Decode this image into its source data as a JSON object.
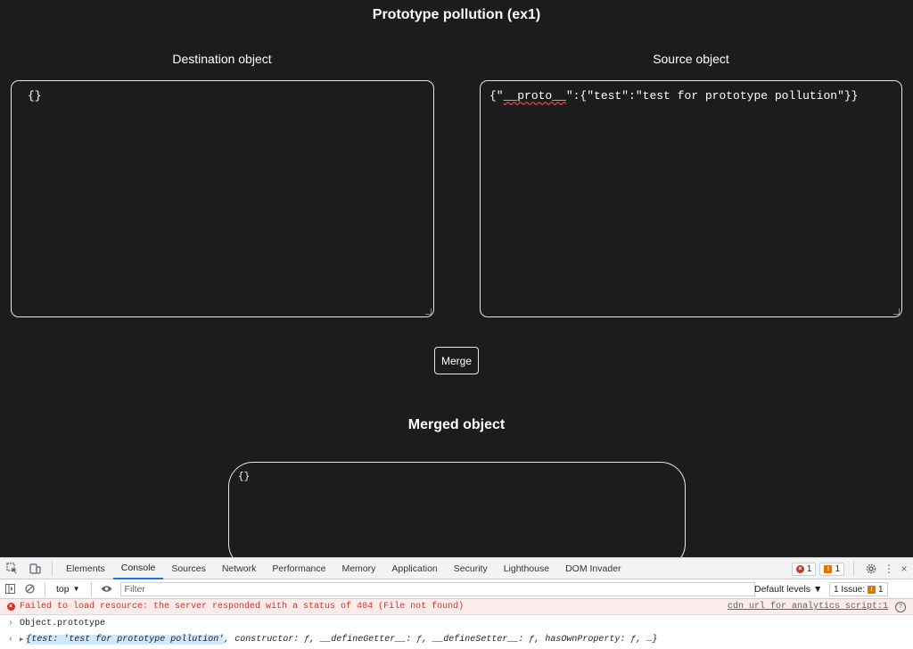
{
  "page": {
    "title": "Prototype pollution (ex1)",
    "destination_label": "Destination object",
    "source_label": "Source object",
    "destination_value": "{}",
    "source_prefix": "{\"",
    "source_proto": "__proto__",
    "source_suffix": "\":{\"test\":\"test for prototype pollution\"}}",
    "merge_button": "Merge",
    "merged_title": "Merged object",
    "merged_value": "{}"
  },
  "devtools": {
    "tabs": [
      "Elements",
      "Console",
      "Sources",
      "Network",
      "Performance",
      "Memory",
      "Application",
      "Security",
      "Lighthouse",
      "DOM Invader"
    ],
    "active_tab": "Console",
    "error_count": "1",
    "warning_count": "1",
    "context": "top",
    "filter_placeholder": "Filter",
    "levels": "Default levels ▼",
    "issues_label": "1 Issue:",
    "issues_count": "1",
    "console": {
      "error_message": "Failed to load resource: the server responded with a status of 404 (File not found)",
      "error_source": "cdn url for analytics script:1",
      "input_command": "Object.prototype",
      "result_highlight": "{test: 'test for prototype pollution'",
      "result_rest": ", constructor: ƒ, __defineGetter__: ƒ, __defineSetter__: ƒ, hasOwnProperty: ƒ, …}"
    }
  },
  "colors": {
    "page_bg": "#1c1c1c",
    "border": "#e6e6e6",
    "devtools_accent": "#1a73e8",
    "error_red": "#d93025"
  }
}
